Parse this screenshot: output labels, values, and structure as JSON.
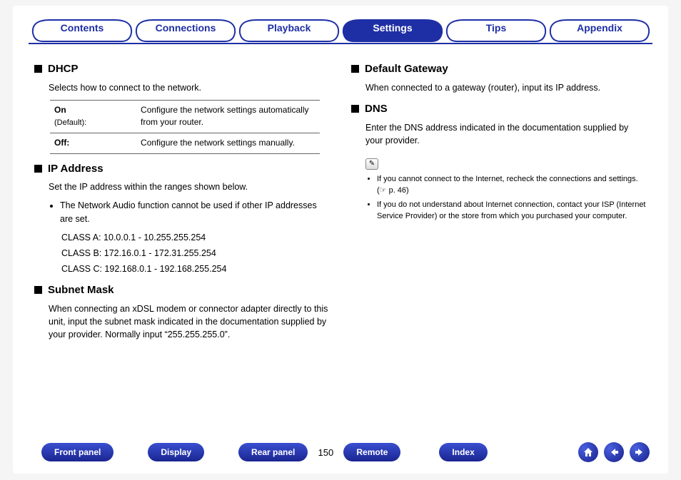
{
  "tabs": {
    "items": [
      "Contents",
      "Connections",
      "Playback",
      "Settings",
      "Tips",
      "Appendix"
    ],
    "active_index": 3
  },
  "left": {
    "dhcp": {
      "title": "DHCP",
      "desc": "Selects how to connect to the network.",
      "rows": [
        {
          "key": "On",
          "keynote": "(Default):",
          "val": "Configure the network settings automatically from your router."
        },
        {
          "key": "Off:",
          "keynote": "",
          "val": "Configure the network settings manually."
        }
      ]
    },
    "ip": {
      "title": "IP Address",
      "desc": "Set the IP address within the ranges shown below.",
      "bullet": "The Network Audio function cannot be used if other IP addresses are set.",
      "classes": [
        "CLASS A: 10.0.0.1 - 10.255.255.254",
        "CLASS B: 172.16.0.1 - 172.31.255.254",
        "CLASS C: 192.168.0.1 - 192.168.255.254"
      ]
    },
    "subnet": {
      "title": "Subnet Mask",
      "desc": "When connecting an xDSL modem or connector adapter directly to this unit, input the subnet mask indicated in the documentation supplied by your provider. Normally input “255.255.255.0”."
    }
  },
  "right": {
    "gateway": {
      "title": "Default Gateway",
      "desc": "When connected to a gateway (router), input its IP address."
    },
    "dns": {
      "title": "DNS",
      "desc": "Enter the DNS address indicated in the documentation supplied by your provider.",
      "notes": [
        "If you cannot connect to the Internet, recheck the connections and settings. (☞ p. 46)",
        "If you do not understand about Internet connection, contact your ISP (Internet Service Provider) or the store from which you purchased your computer."
      ]
    }
  },
  "bottom": {
    "buttons": [
      "Front panel",
      "Display",
      "Rear panel"
    ],
    "page": "150",
    "buttons2": [
      "Remote",
      "Index"
    ]
  }
}
